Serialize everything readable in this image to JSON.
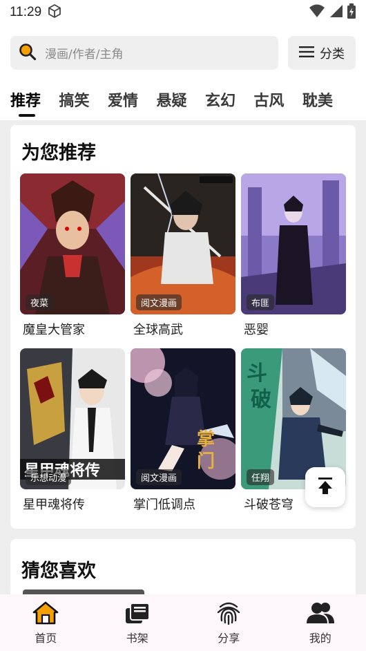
{
  "status_bar": {
    "time": "11:29"
  },
  "search": {
    "placeholder": "漫画/作者/主角"
  },
  "category_button": {
    "label": "分类"
  },
  "tabs": [
    {
      "label": "推荐",
      "active": true
    },
    {
      "label": "搞笑"
    },
    {
      "label": "爱情"
    },
    {
      "label": "悬疑"
    },
    {
      "label": "玄幻"
    },
    {
      "label": "古风"
    },
    {
      "label": "耽美"
    }
  ],
  "recommend": {
    "title": "为您推荐",
    "items": [
      {
        "title": "魔皇大管家",
        "tag": "夜菜"
      },
      {
        "title": "全球高武",
        "tag": "阅文漫画"
      },
      {
        "title": "恶婴",
        "tag": "布匪"
      },
      {
        "title": "星甲魂将传",
        "tag": "乐想动漫"
      },
      {
        "title": "掌门低调点",
        "tag": "阅文漫画"
      },
      {
        "title": "斗破苍穹",
        "tag": "任翔"
      }
    ]
  },
  "guess": {
    "title": "猜您喜欢"
  },
  "bottom_nav": [
    {
      "label": "首页",
      "icon": "home-icon",
      "active": true
    },
    {
      "label": "书架",
      "icon": "bookshelf-icon"
    },
    {
      "label": "分享",
      "icon": "fingerprint-icon"
    },
    {
      "label": "我的",
      "icon": "profile-icon"
    }
  ],
  "colors": {
    "accent": "#f5a000",
    "nav_bg": "#fdf6fb",
    "page_bg": "#eeeeee"
  }
}
